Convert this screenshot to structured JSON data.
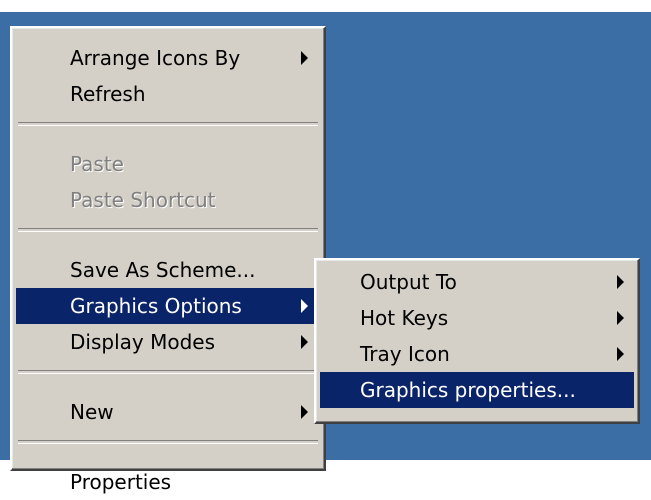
{
  "main_menu": {
    "items": [
      {
        "label": "Arrange Icons By",
        "submenu": true,
        "disabled": false,
        "selected": false
      },
      {
        "label": "Refresh",
        "submenu": false,
        "disabled": false,
        "selected": false
      },
      {
        "separator": true
      },
      {
        "label": "Paste",
        "submenu": false,
        "disabled": true,
        "selected": false
      },
      {
        "label": "Paste Shortcut",
        "submenu": false,
        "disabled": true,
        "selected": false
      },
      {
        "separator": true
      },
      {
        "label": "Save As Scheme...",
        "submenu": false,
        "disabled": false,
        "selected": false
      },
      {
        "label": "Graphics Options",
        "submenu": true,
        "disabled": false,
        "selected": true
      },
      {
        "label": "Display Modes",
        "submenu": true,
        "disabled": false,
        "selected": false
      },
      {
        "separator": true
      },
      {
        "label": "New",
        "submenu": true,
        "disabled": false,
        "selected": false
      },
      {
        "separator": true
      },
      {
        "label": "Properties",
        "submenu": false,
        "disabled": false,
        "selected": false
      }
    ]
  },
  "sub_menu": {
    "items": [
      {
        "label": "Output To",
        "submenu": true,
        "disabled": false,
        "selected": false
      },
      {
        "label": "Hot Keys",
        "submenu": true,
        "disabled": false,
        "selected": false
      },
      {
        "label": "Tray Icon",
        "submenu": true,
        "disabled": false,
        "selected": false
      },
      {
        "label": "Graphics properties...",
        "submenu": false,
        "disabled": false,
        "selected": true
      }
    ]
  },
  "colors": {
    "desktop": "#3a6ea5",
    "menu_face": "#d4d0c8",
    "highlight": "#0a246a",
    "disabled_text": "#808080"
  }
}
